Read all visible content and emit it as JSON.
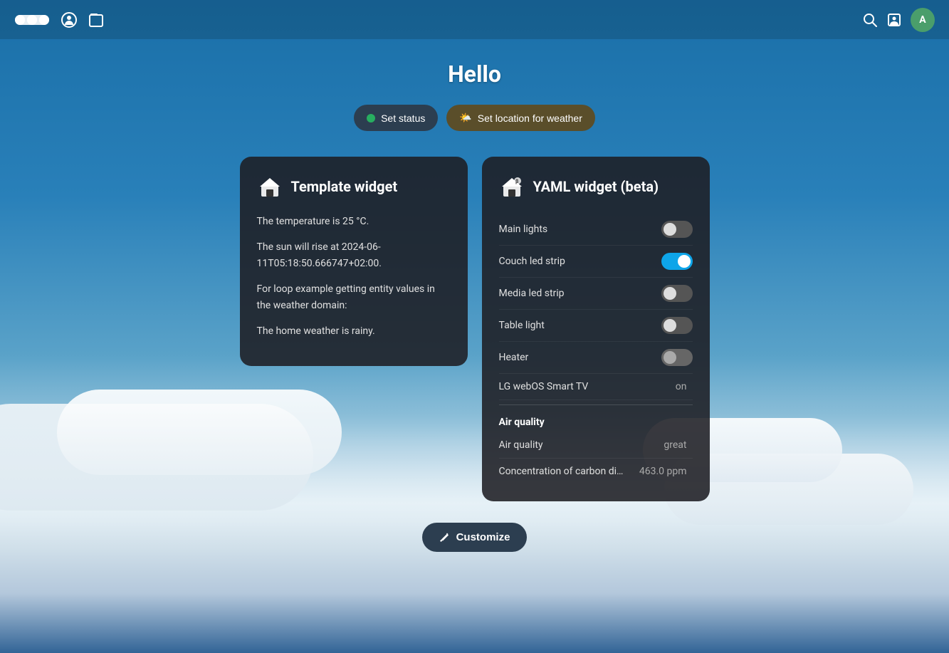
{
  "app": {
    "title": "Hello"
  },
  "topbar": {
    "nav_items": [
      {
        "id": "status",
        "label": "Status"
      },
      {
        "id": "files",
        "label": "Files"
      }
    ],
    "search_label": "Search",
    "contacts_label": "Contacts",
    "avatar_label": "A"
  },
  "actions": {
    "set_status_label": "Set status",
    "set_weather_label": "Set location for weather"
  },
  "template_widget": {
    "title": "Template widget",
    "lines": [
      "The temperature is 25 °C.",
      "The sun will rise at\n2024-06-11T05:18:50.666747+02:00.",
      "For loop example getting entity values in\nthe weather domain:",
      "The home weather is rainy."
    ]
  },
  "yaml_widget": {
    "title": "YAML widget (beta)",
    "items": [
      {
        "label": "Main lights",
        "type": "toggle",
        "state": "off"
      },
      {
        "label": "Couch led strip",
        "type": "toggle",
        "state": "on"
      },
      {
        "label": "Media led strip",
        "type": "toggle",
        "state": "off"
      },
      {
        "label": "Table light",
        "type": "toggle",
        "state": "off"
      },
      {
        "label": "Heater",
        "type": "toggle",
        "state": "disabled"
      },
      {
        "label": "LG webOS Smart TV",
        "type": "text",
        "value": "on"
      }
    ],
    "section_label": "Air quality",
    "air_quality_items": [
      {
        "label": "Air quality",
        "value": "great"
      },
      {
        "label": "Concentration of carbon di…",
        "value": "463.0 ppm"
      }
    ]
  },
  "customize_btn": "Customize"
}
